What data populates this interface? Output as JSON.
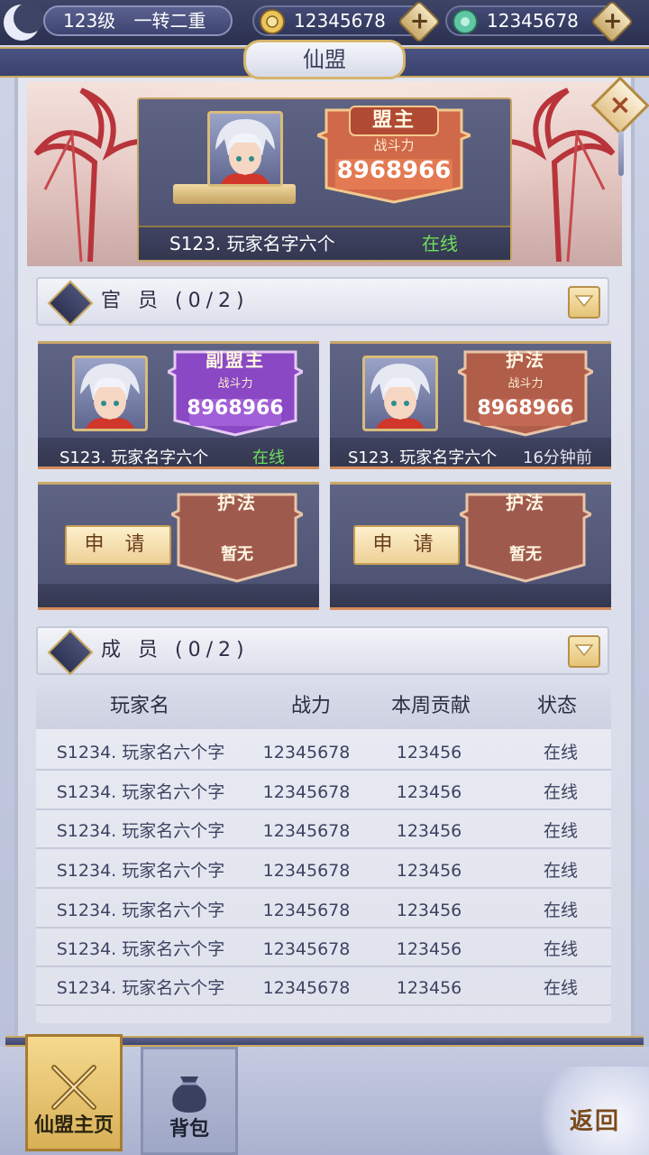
{
  "header": {
    "level": "123级",
    "rebirth": "一转二重",
    "gold_value": "12345678",
    "jade_value": "12345678",
    "gold_icon": "coin-icon",
    "jade_icon": "jade-icon"
  },
  "title": "仙盟",
  "leader": {
    "rank": "盟主",
    "power_label": "战斗力",
    "power": "8968966",
    "name": "S123. 玩家名字六个",
    "status": "在线"
  },
  "officers_section": {
    "title": "官 员 (0/2)"
  },
  "officers": [
    {
      "rank": "副盟主",
      "power_label": "战斗力",
      "power": "8968966",
      "name": "S123. 玩家名字六个",
      "status": "在线"
    },
    {
      "rank": "护法",
      "power_label": "战斗力",
      "power": "8968966",
      "name": "S123. 玩家名字六个",
      "status": "16分钟前"
    }
  ],
  "empty_slots": [
    {
      "rank": "护法",
      "apply_label": "申 请",
      "empty_text": "暂无"
    },
    {
      "rank": "护法",
      "apply_label": "申 请",
      "empty_text": "暂无"
    }
  ],
  "members_section": {
    "title": "成 员 (0/2)"
  },
  "members_table": {
    "headers": [
      "玩家名",
      "战力",
      "本周贡献",
      "状态"
    ],
    "rows": [
      [
        "S1234. 玩家名六个字",
        "12345678",
        "123456",
        "在线"
      ],
      [
        "S1234. 玩家名六个字",
        "12345678",
        "123456",
        "在线"
      ],
      [
        "S1234. 玩家名六个字",
        "12345678",
        "123456",
        "在线"
      ],
      [
        "S1234. 玩家名六个字",
        "12345678",
        "123456",
        "在线"
      ],
      [
        "S1234. 玩家名六个字",
        "12345678",
        "123456",
        "在线"
      ],
      [
        "S1234. 玩家名六个字",
        "12345678",
        "123456",
        "在线"
      ],
      [
        "S1234. 玩家名六个字",
        "12345678",
        "123456",
        "在线"
      ]
    ]
  },
  "nav": {
    "tabs": [
      {
        "label": "仙盟主页",
        "icon": "crossed-swords-icon",
        "active": true
      },
      {
        "label": "背包",
        "icon": "bag-icon",
        "active": false
      }
    ],
    "back_label": "返回"
  },
  "colors": {
    "online": "#6fe05a",
    "gold_accent": "#c9a95e",
    "leader_badge": "#c8603e",
    "vice_badge": "#8a48c4",
    "guard_badge": "#b05d4a"
  }
}
